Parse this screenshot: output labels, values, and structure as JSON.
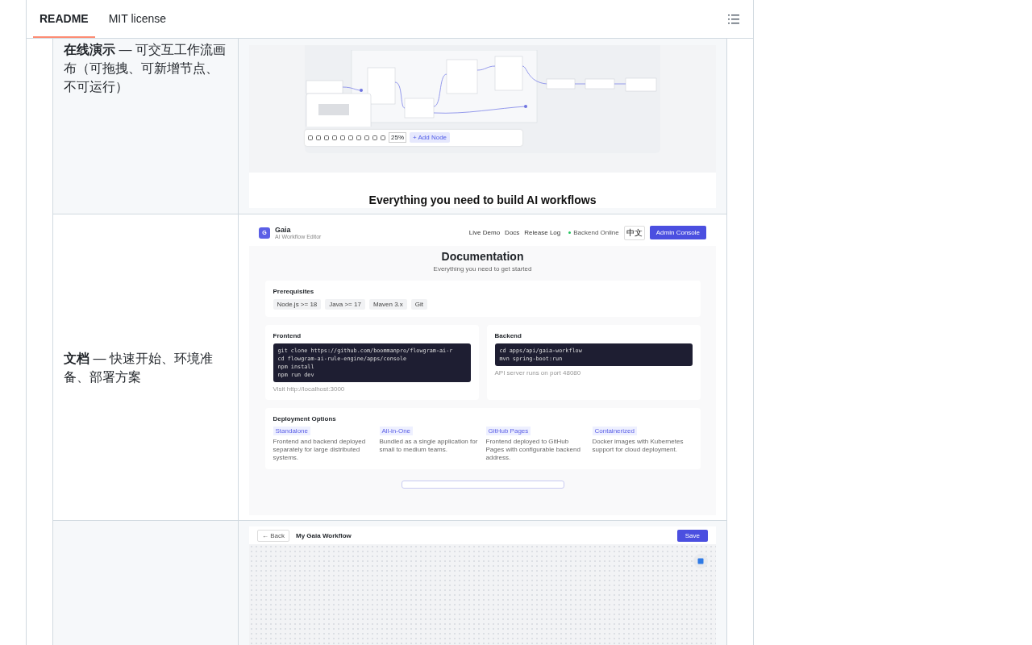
{
  "tabs": [
    {
      "label": "README",
      "selected": true
    },
    {
      "label": "MIT license",
      "selected": false
    }
  ],
  "rows": [
    {
      "description": "**在线演示** — 可交互工作流画布（可拖拽、可新增节点、不可运行）",
      "screenshot": {
        "kind": "canvas",
        "zoom": "25%",
        "add_button": "+ Add Node",
        "heading": "Everything you need to build AI workflows"
      }
    },
    {
      "description": "**文档** — 快速开始、环境准备、部署方案",
      "screenshot": {
        "kind": "docs",
        "logo": "G",
        "brand": "Gaia",
        "tagline": "AI Workflow Editor",
        "nav": [
          "Live Demo",
          "Docs",
          "Release Log"
        ],
        "status": "Backend Online",
        "language": "中文",
        "admin": "Admin Console",
        "title": "Documentation",
        "subtitle": "Everything you need to get started",
        "prerequisites": {
          "title": "Prerequisites",
          "chips": [
            "Node.js >= 18",
            "Java >= 17",
            "Maven 3.x",
            "Git"
          ]
        },
        "setup": [
          {
            "title": "Frontend",
            "code": [
              "git clone https://github.com/boommanpro/flowgram-ai-r",
              "cd flowgram-ai-rule-engine/apps/console",
              "npm install",
              "npm run dev"
            ],
            "note": "Visit http://localhost:3000"
          },
          {
            "title": "Backend",
            "code": [
              "cd apps/api/gaia-workflow",
              "mvn spring-boot:run"
            ],
            "note": "API server runs on port 48080"
          }
        ],
        "deployment": {
          "title": "Deployment Options",
          "options": [
            {
              "tag": "Standalone",
              "text": "Frontend and backend deployed separately for large distributed systems."
            },
            {
              "tag": "All-in-One",
              "text": "Bundled as a single application for small to medium teams."
            },
            {
              "tag": "GitHub Pages",
              "text": "Frontend deployed to GitHub Pages with configurable backend address."
            },
            {
              "tag": "Containerized",
              "text": "Docker images with Kubernetes support for cloud deployment."
            }
          ]
        }
      }
    },
    {
      "screenshot": {
        "kind": "editor",
        "back": "← Back",
        "title": "My Gaia Workflow",
        "save": "Save"
      }
    }
  ]
}
